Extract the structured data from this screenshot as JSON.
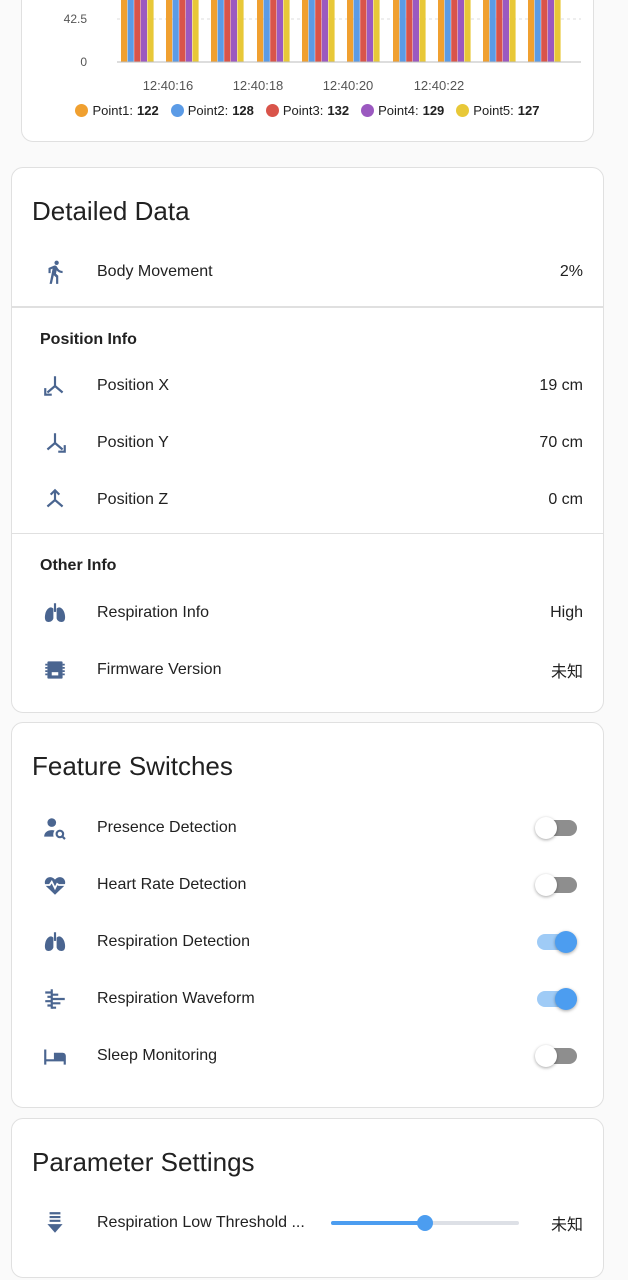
{
  "colors": {
    "accent": "#4c9df0",
    "icon": "#4a6590",
    "point1": "#f0a030",
    "point2": "#5b9be6",
    "point3": "#d9544a",
    "point4": "#9b59c0",
    "point5": "#e8c838"
  },
  "chart_data": {
    "type": "bar",
    "y_ticks": [
      "42.5",
      "0"
    ],
    "categories": [
      "12:40:16",
      "12:40:18",
      "12:40:20",
      "12:40:22"
    ],
    "series": [
      {
        "name": "Point1",
        "latest": "122"
      },
      {
        "name": "Point2",
        "latest": "128"
      },
      {
        "name": "Point3",
        "latest": "132"
      },
      {
        "name": "Point4",
        "latest": "129"
      },
      {
        "name": "Point5",
        "latest": "127"
      }
    ]
  },
  "detailed": {
    "title": "Detailed Data",
    "body_movement": {
      "label": "Body Movement",
      "value": "2%",
      "icon": "walk-icon"
    },
    "position_header": "Position Info",
    "position_x": {
      "label": "Position X",
      "value": "19 cm",
      "icon": "axis-x-icon"
    },
    "position_y": {
      "label": "Position Y",
      "value": "70 cm",
      "icon": "axis-y-icon"
    },
    "position_z": {
      "label": "Position Z",
      "value": "0 cm",
      "icon": "axis-z-icon"
    },
    "other_header": "Other Info",
    "respiration_info": {
      "label": "Respiration Info",
      "value": "High",
      "icon": "lungs-icon"
    },
    "firmware": {
      "label": "Firmware Version",
      "value": "未知",
      "icon": "chip-icon"
    }
  },
  "switches": {
    "title": "Feature Switches",
    "items": [
      {
        "label": "Presence Detection",
        "on": false,
        "icon": "account-search-icon"
      },
      {
        "label": "Heart Rate Detection",
        "on": false,
        "icon": "heart-pulse-icon"
      },
      {
        "label": "Respiration Detection",
        "on": true,
        "icon": "lungs-icon"
      },
      {
        "label": "Respiration Waveform",
        "on": true,
        "icon": "waveform-icon"
      },
      {
        "label": "Sleep Monitoring",
        "on": false,
        "icon": "bed-icon"
      }
    ]
  },
  "params": {
    "title": "Parameter Settings",
    "respiration_low": {
      "label": "Respiration Low Threshold ...",
      "value": "未知",
      "slider_fraction": 0.5,
      "icon": "arrow-down-lines-icon"
    }
  }
}
